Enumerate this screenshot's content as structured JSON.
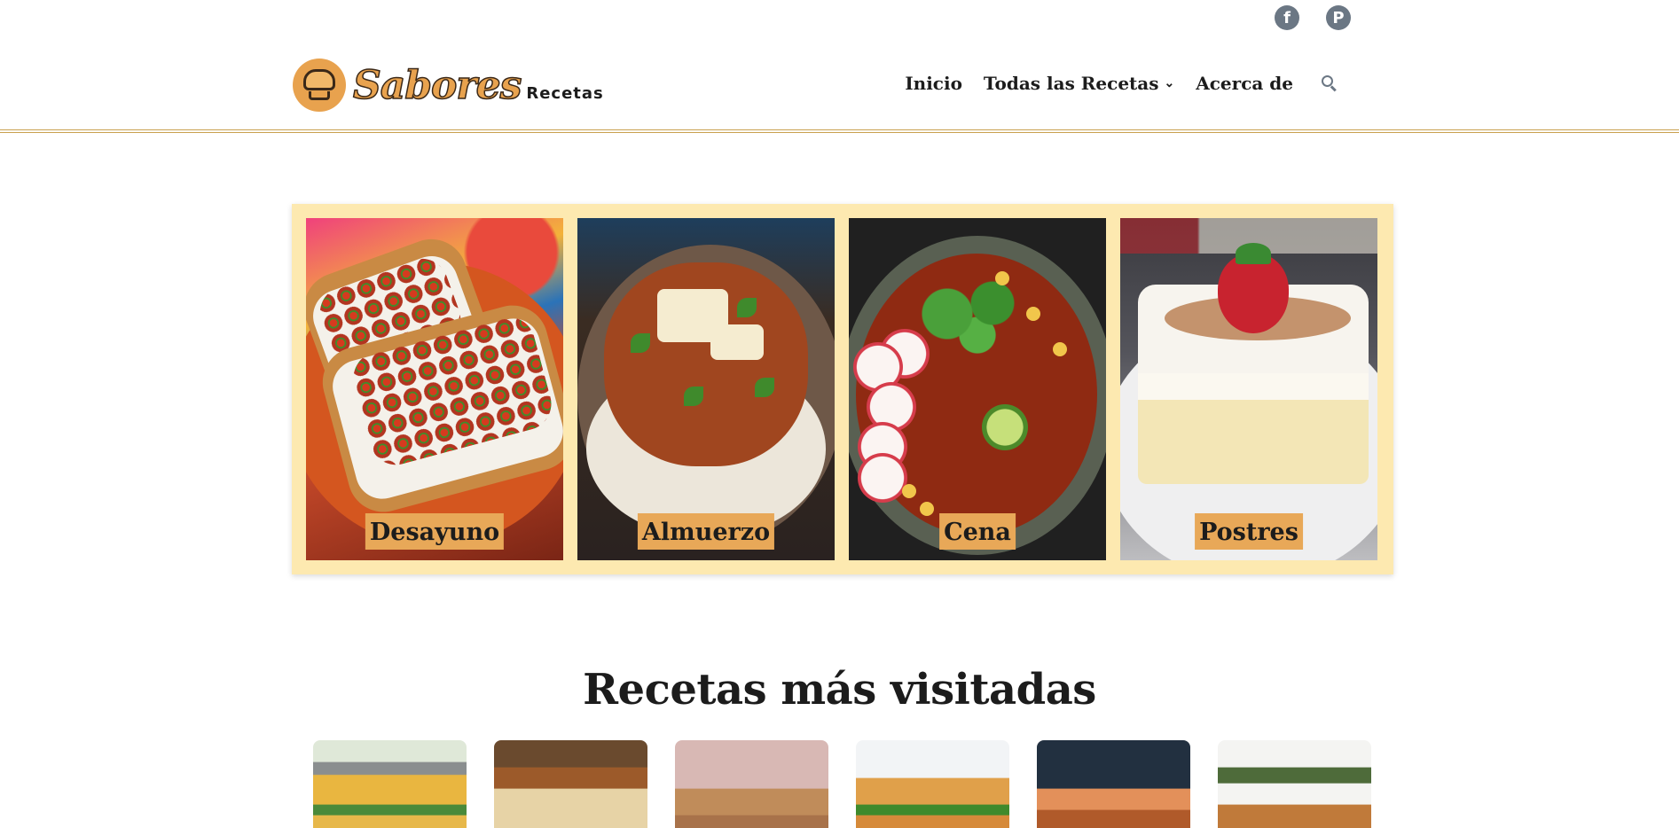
{
  "social": {
    "facebook_icon": "facebook-icon",
    "pinterest_icon": "pinterest-icon"
  },
  "header": {
    "logo_script": "Sabores",
    "logo_sub": "Recetas",
    "nav": {
      "home": "Inicio",
      "all_recipes": "Todas las Recetas",
      "about": "Acerca de"
    }
  },
  "categories": [
    {
      "label": "Desayuno"
    },
    {
      "label": "Almuerzo"
    },
    {
      "label": "Cena"
    },
    {
      "label": "Postres"
    }
  ],
  "visited": {
    "title": "Recetas más visitadas"
  },
  "colors": {
    "accent": "#e8a858",
    "panel": "#fde9b0",
    "header_line": "#c9a14f"
  }
}
